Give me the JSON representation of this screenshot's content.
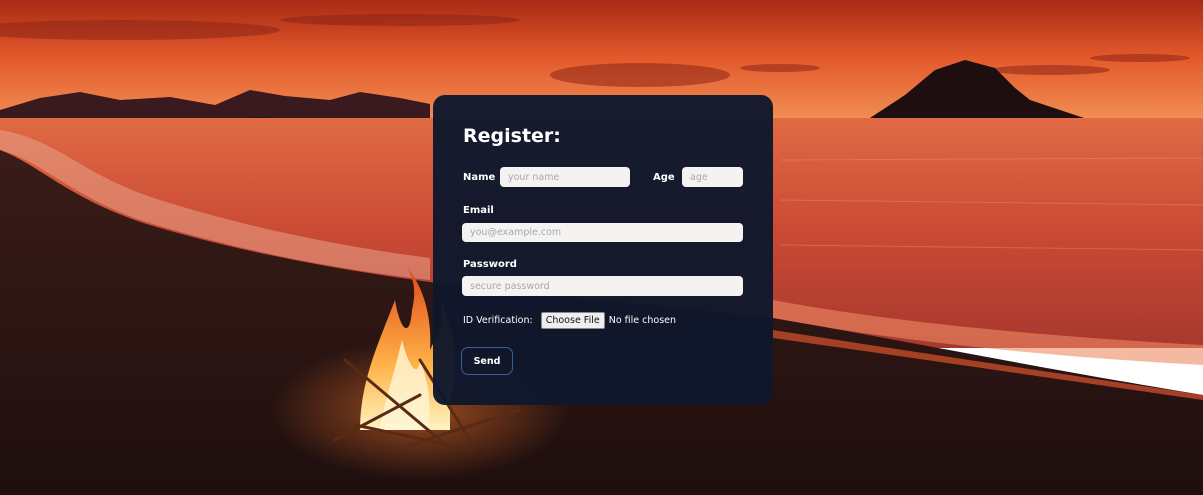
{
  "background": {
    "scene": "sunset-beach-campfire",
    "colors": {
      "sky_top": "#b8341a",
      "sky_glow": "#f07a3a",
      "sea": "#d85a3a",
      "sand": "#2a1412",
      "fire": "#ffb347"
    }
  },
  "form": {
    "title": "Register:",
    "name": {
      "label": "Name",
      "placeholder": "your name",
      "value": ""
    },
    "age": {
      "label": "Age",
      "placeholder": "age",
      "value": ""
    },
    "email": {
      "label": "Email",
      "placeholder": "you@example.com",
      "value": ""
    },
    "password": {
      "label": "Password",
      "placeholder": "secure password",
      "value": ""
    },
    "id_verification": {
      "label": "ID Verification:",
      "button_label": "Choose File",
      "status": "No file chosen"
    },
    "submit_label": "Send",
    "colors": {
      "card": "#10182c",
      "input_bg": "#f5f2f2",
      "button_border": "#3b5d9c"
    }
  }
}
